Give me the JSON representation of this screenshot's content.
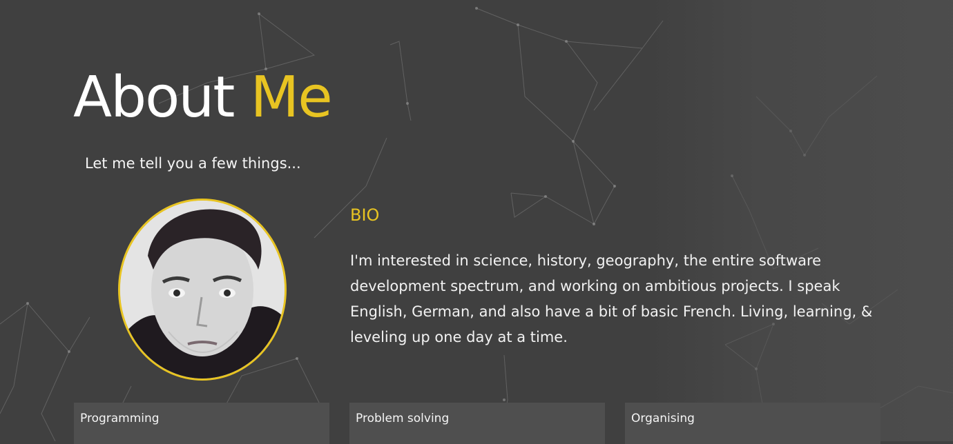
{
  "header": {
    "title_main": "About",
    "title_accent": "Me",
    "subtitle": "Let me tell you a few things..."
  },
  "bio": {
    "heading": "BIO",
    "text": "I'm interested in science, history, geography, the entire software development spectrum, and working on ambitious projects. I speak English, German, and also have a bit of basic French. Living, learning, & leveling up one day at a time."
  },
  "skills": [
    {
      "label": "Programming"
    },
    {
      "label": "Problem solving"
    },
    {
      "label": "Organising"
    }
  ],
  "colors": {
    "background": "#404040",
    "accent": "#e8c422",
    "text": "#f2f2f2",
    "card": "#4f4f4f"
  },
  "icons": {
    "background": "network-lines-background",
    "avatar": "profile-photo"
  }
}
